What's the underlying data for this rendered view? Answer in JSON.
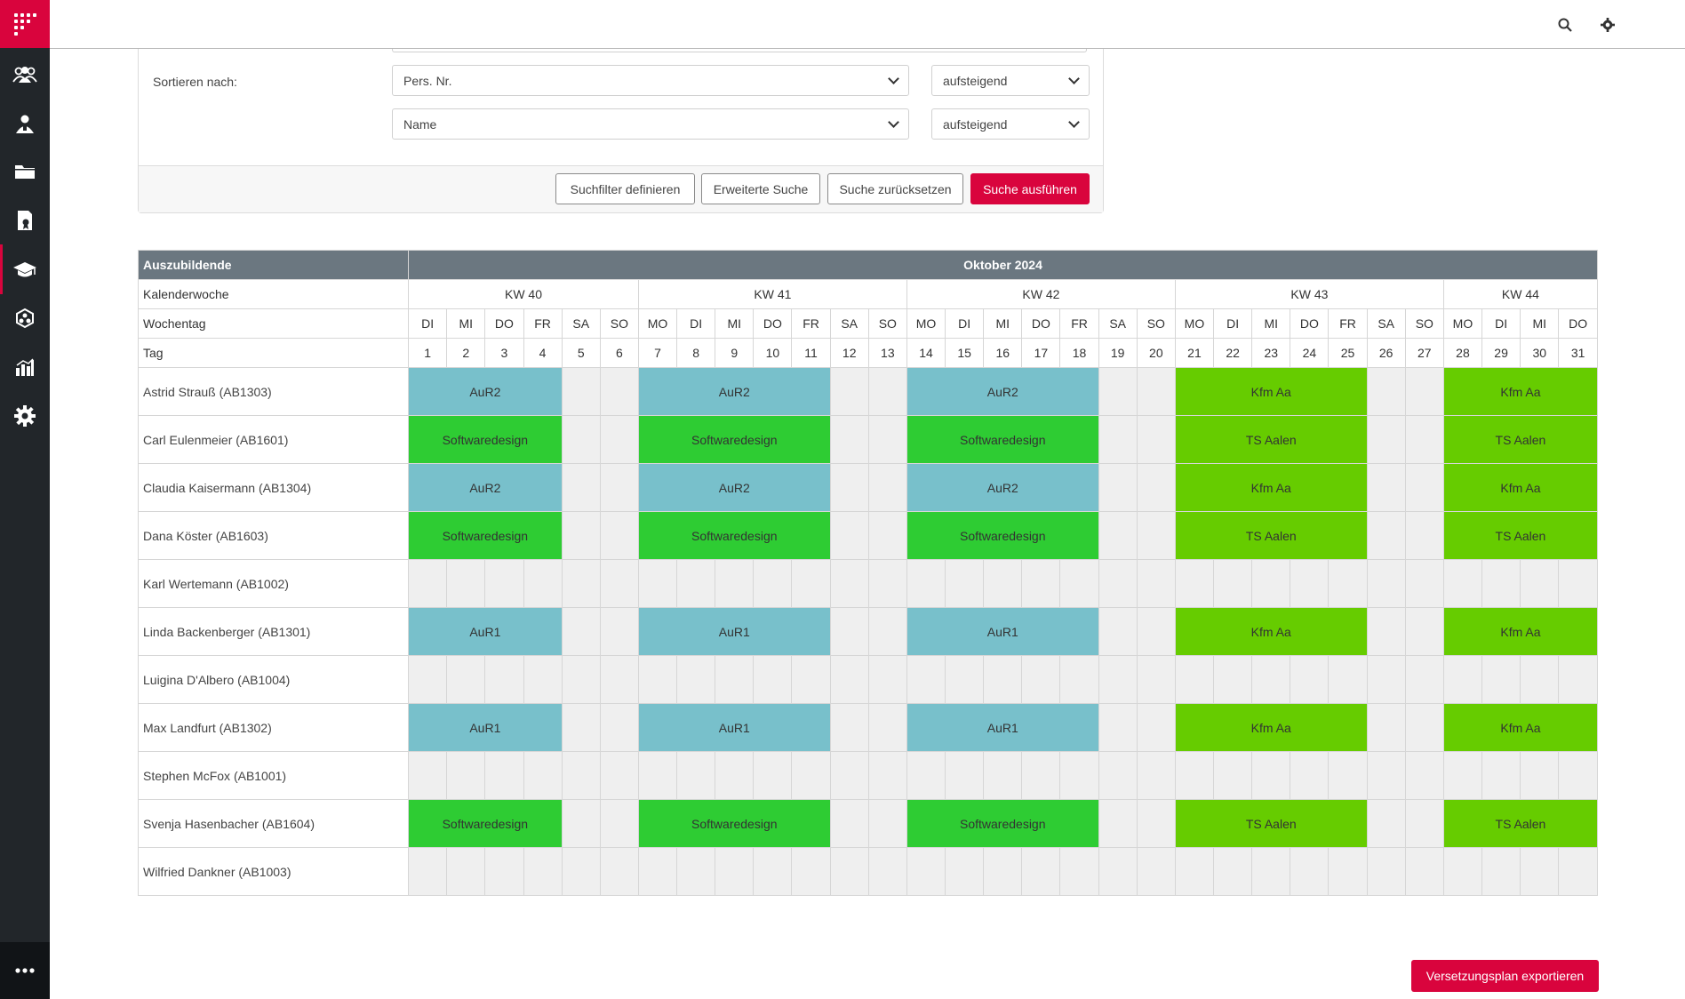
{
  "sidebar": {
    "items": [
      {
        "name": "users-icon"
      },
      {
        "name": "person-icon"
      },
      {
        "name": "folder-icon"
      },
      {
        "name": "document-icon"
      },
      {
        "name": "graduation-cap-icon",
        "active": true
      },
      {
        "name": "network-icon"
      },
      {
        "name": "chart-icon"
      },
      {
        "name": "gear-icon"
      }
    ],
    "more": "more-icon"
  },
  "header": {
    "icons": [
      "search-icon",
      "settings-icon",
      "avatar"
    ]
  },
  "filter": {
    "sort_label": "Sortieren nach:",
    "sort1": {
      "field": "Pers. Nr.",
      "order": "aufsteigend"
    },
    "sort2": {
      "field": "Name",
      "order": "aufsteigend"
    },
    "buttons": {
      "define": "Suchfilter definieren",
      "advanced": "Erweiterte Suche",
      "reset": "Suche zurücksetzen",
      "run": "Suche ausführen"
    }
  },
  "plan": {
    "col_header": "Auszubildende",
    "month": "Oktober 2024",
    "row_labels": {
      "week": "Kalenderwoche",
      "weekday": "Wochentag",
      "day": "Tag"
    },
    "weeks": [
      {
        "label": "KW 40",
        "span": 6
      },
      {
        "label": "KW 41",
        "span": 7
      },
      {
        "label": "KW 42",
        "span": 7
      },
      {
        "label": "KW 43",
        "span": 7
      },
      {
        "label": "KW 44",
        "span": 4
      }
    ],
    "weekdays": [
      "DI",
      "MI",
      "DO",
      "FR",
      "SA",
      "SO",
      "MO",
      "DI",
      "MI",
      "DO",
      "FR",
      "SA",
      "SO",
      "MO",
      "DI",
      "MI",
      "DO",
      "FR",
      "SA",
      "SO",
      "MO",
      "DI",
      "MI",
      "DO",
      "FR",
      "SA",
      "SO",
      "MO",
      "DI",
      "MI",
      "DO"
    ],
    "days": [
      "1",
      "2",
      "3",
      "4",
      "5",
      "6",
      "7",
      "8",
      "9",
      "10",
      "11",
      "12",
      "13",
      "14",
      "15",
      "16",
      "17",
      "18",
      "19",
      "20",
      "21",
      "22",
      "23",
      "24",
      "25",
      "26",
      "27",
      "28",
      "29",
      "30",
      "31"
    ],
    "trainees": [
      {
        "name": "Astrid Strauß (AB1303)",
        "t1": "AuR2",
        "t2": "Kfm Aa",
        "c1": "aur",
        "c2": "lime"
      },
      {
        "name": "Carl Eulenmeier (AB1601)",
        "t1": "Softwaredesign",
        "t2": "TS Aalen",
        "c1": "sw",
        "c2": "lime"
      },
      {
        "name": "Claudia Kaisermann (AB1304)",
        "t1": "AuR2",
        "t2": "Kfm Aa",
        "c1": "aur",
        "c2": "lime"
      },
      {
        "name": "Dana Köster (AB1603)",
        "t1": "Softwaredesign",
        "t2": "TS Aalen",
        "c1": "sw",
        "c2": "lime"
      },
      {
        "name": "Karl Wertemann (AB1002)",
        "t1": null,
        "t2": null
      },
      {
        "name": "Linda Backenberger (AB1301)",
        "t1": "AuR1",
        "t2": "Kfm Aa",
        "c1": "aur",
        "c2": "lime"
      },
      {
        "name": "Luigina D'Albero (AB1004)",
        "t1": null,
        "t2": null
      },
      {
        "name": "Max Landfurt (AB1302)",
        "t1": "AuR1",
        "t2": "Kfm Aa",
        "c1": "aur",
        "c2": "lime"
      },
      {
        "name": "Stephen McFox (AB1001)",
        "t1": null,
        "t2": null
      },
      {
        "name": "Svenja Hasenbacher (AB1604)",
        "t1": "Softwaredesign",
        "t2": "TS Aalen",
        "c1": "sw",
        "c2": "lime"
      },
      {
        "name": "Wilfried Dankner (AB1003)",
        "t1": null,
        "t2": null
      }
    ]
  },
  "export_label": "Versetzungsplan exportieren",
  "colors": {
    "brand": "#d9043d",
    "sidebar": "#22262a",
    "header_dark": "#6b7780",
    "aur": "#78c0cb",
    "softwaredesign": "#2ecc33",
    "kfm": "#66cc00",
    "empty": "#efefef"
  }
}
